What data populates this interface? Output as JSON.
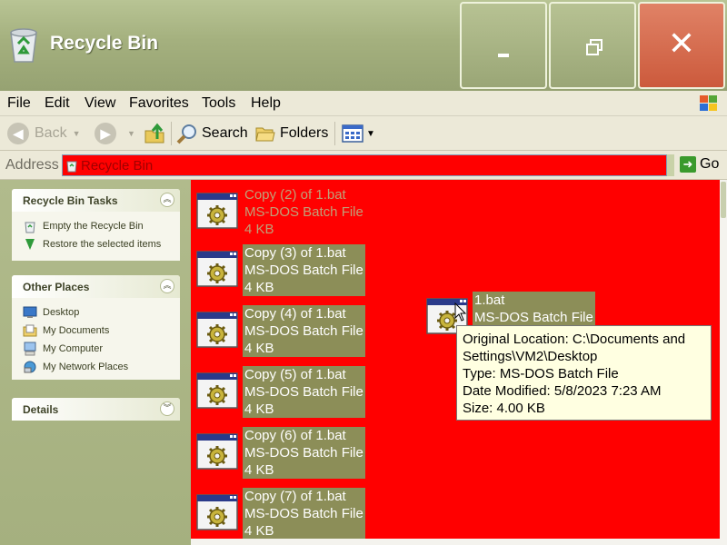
{
  "window": {
    "title": "Recycle Bin",
    "minimize_label": "_",
    "close_label": "✕"
  },
  "menu": [
    "File",
    "Edit",
    "View",
    "Favorites",
    "Tools",
    "Help"
  ],
  "toolbar": {
    "back": "Back",
    "search": "Search",
    "folders": "Folders"
  },
  "address": {
    "label": "Address",
    "value": "Recycle Bin",
    "go": "Go"
  },
  "tasks_panel": {
    "title": "Recycle Bin Tasks",
    "items": [
      "Empty the Recycle Bin",
      "Restore the selected items"
    ]
  },
  "places_panel": {
    "title": "Other Places",
    "items": [
      "Desktop",
      "My Documents",
      "My Computer",
      "My Network Places"
    ]
  },
  "details_panel": {
    "title": "Details"
  },
  "files": [
    {
      "name": "Copy (2) of 1.bat",
      "type": "MS-DOS Batch File",
      "size": "4 KB",
      "selected": false
    },
    {
      "name": "Copy (3) of 1.bat",
      "type": "MS-DOS Batch File",
      "size": "4 KB",
      "selected": true
    },
    {
      "name": "Copy (4) of 1.bat",
      "type": "MS-DOS Batch File",
      "size": "4 KB",
      "selected": true
    },
    {
      "name": "Copy (5) of 1.bat",
      "type": "MS-DOS Batch File",
      "size": "4 KB",
      "selected": true
    },
    {
      "name": "Copy (6) of 1.bat",
      "type": "MS-DOS Batch File",
      "size": "4 KB",
      "selected": true
    },
    {
      "name": "Copy (7) of 1.bat",
      "type": "MS-DOS Batch File",
      "size": "4 KB",
      "selected": true
    },
    {
      "name": "1.bat",
      "type": "MS-DOS Batch File",
      "selected": true
    }
  ],
  "tooltip": {
    "location_line1": "Original Location: C:\\Documents and",
    "location_line2": "Settings\\VM2\\Desktop",
    "type": "Type: MS-DOS Batch File",
    "modified": "Date Modified: 5/8/2023 7:23 AM",
    "size": "Size: 4.00 KB"
  },
  "colors": {
    "content_bg": "#ff0000",
    "selection": "#8c8e58",
    "theme_olive": "#a5b07f",
    "close_button": "#cc5a3c"
  }
}
